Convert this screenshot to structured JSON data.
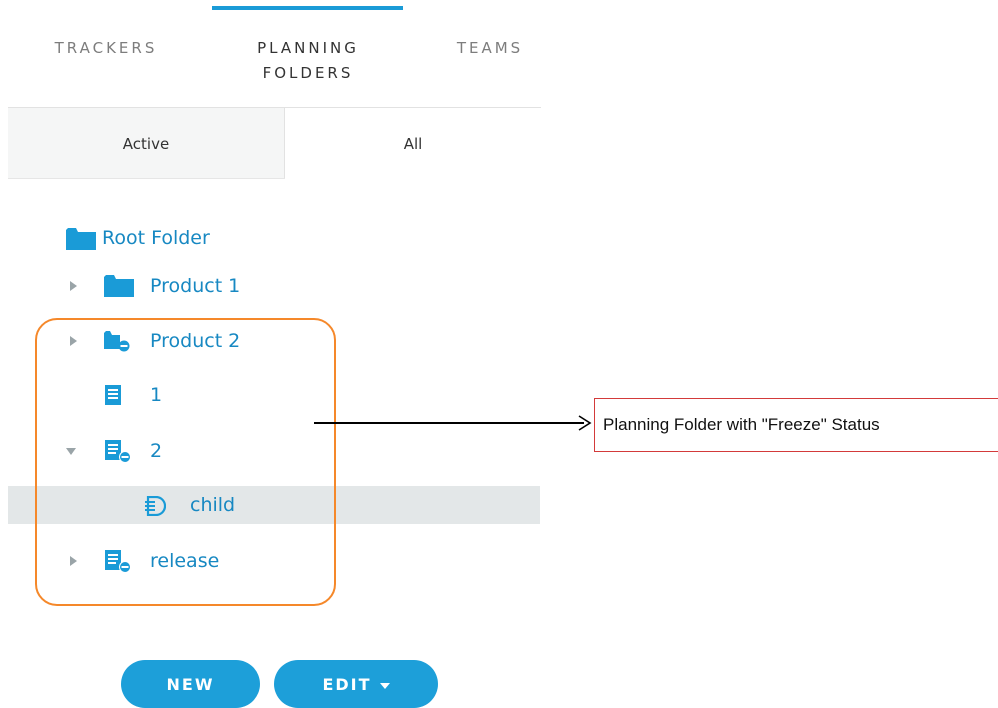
{
  "tabs": [
    {
      "line1": "TRACKERS",
      "line2": ""
    },
    {
      "line1": "PLANNING",
      "line2": "FOLDERS"
    },
    {
      "line1": "TEAMS",
      "line2": ""
    }
  ],
  "active_tab_index": 1,
  "filter": {
    "active_label": "Active",
    "all_label": "All",
    "selected": "All"
  },
  "tree": {
    "root": {
      "label": "Root Folder",
      "icon": "folder-icon"
    },
    "items": [
      {
        "label": "Product 1",
        "icon": "folder-icon",
        "expanded": false
      },
      {
        "label": "Product 2",
        "icon": "folder-freeze-icon",
        "expanded": false
      },
      {
        "label": "1",
        "icon": "planning-folder-icon",
        "expanded": null
      },
      {
        "label": "2",
        "icon": "planning-folder-freeze-icon",
        "expanded": true
      },
      {
        "label": "child",
        "icon": "planning-folder-child-icon",
        "selected": true
      },
      {
        "label": "release",
        "icon": "planning-folder-freeze-icon",
        "expanded": false
      }
    ]
  },
  "annotation": {
    "text": "Planning Folder with \"Freeze\" Status"
  },
  "buttons": {
    "new_label": "NEW",
    "edit_label": "EDIT"
  },
  "colors": {
    "accent": "#1d9fd9",
    "tree_text": "#1788c2",
    "highlight": "#f5882a",
    "callout_border": "#d33a3a"
  }
}
